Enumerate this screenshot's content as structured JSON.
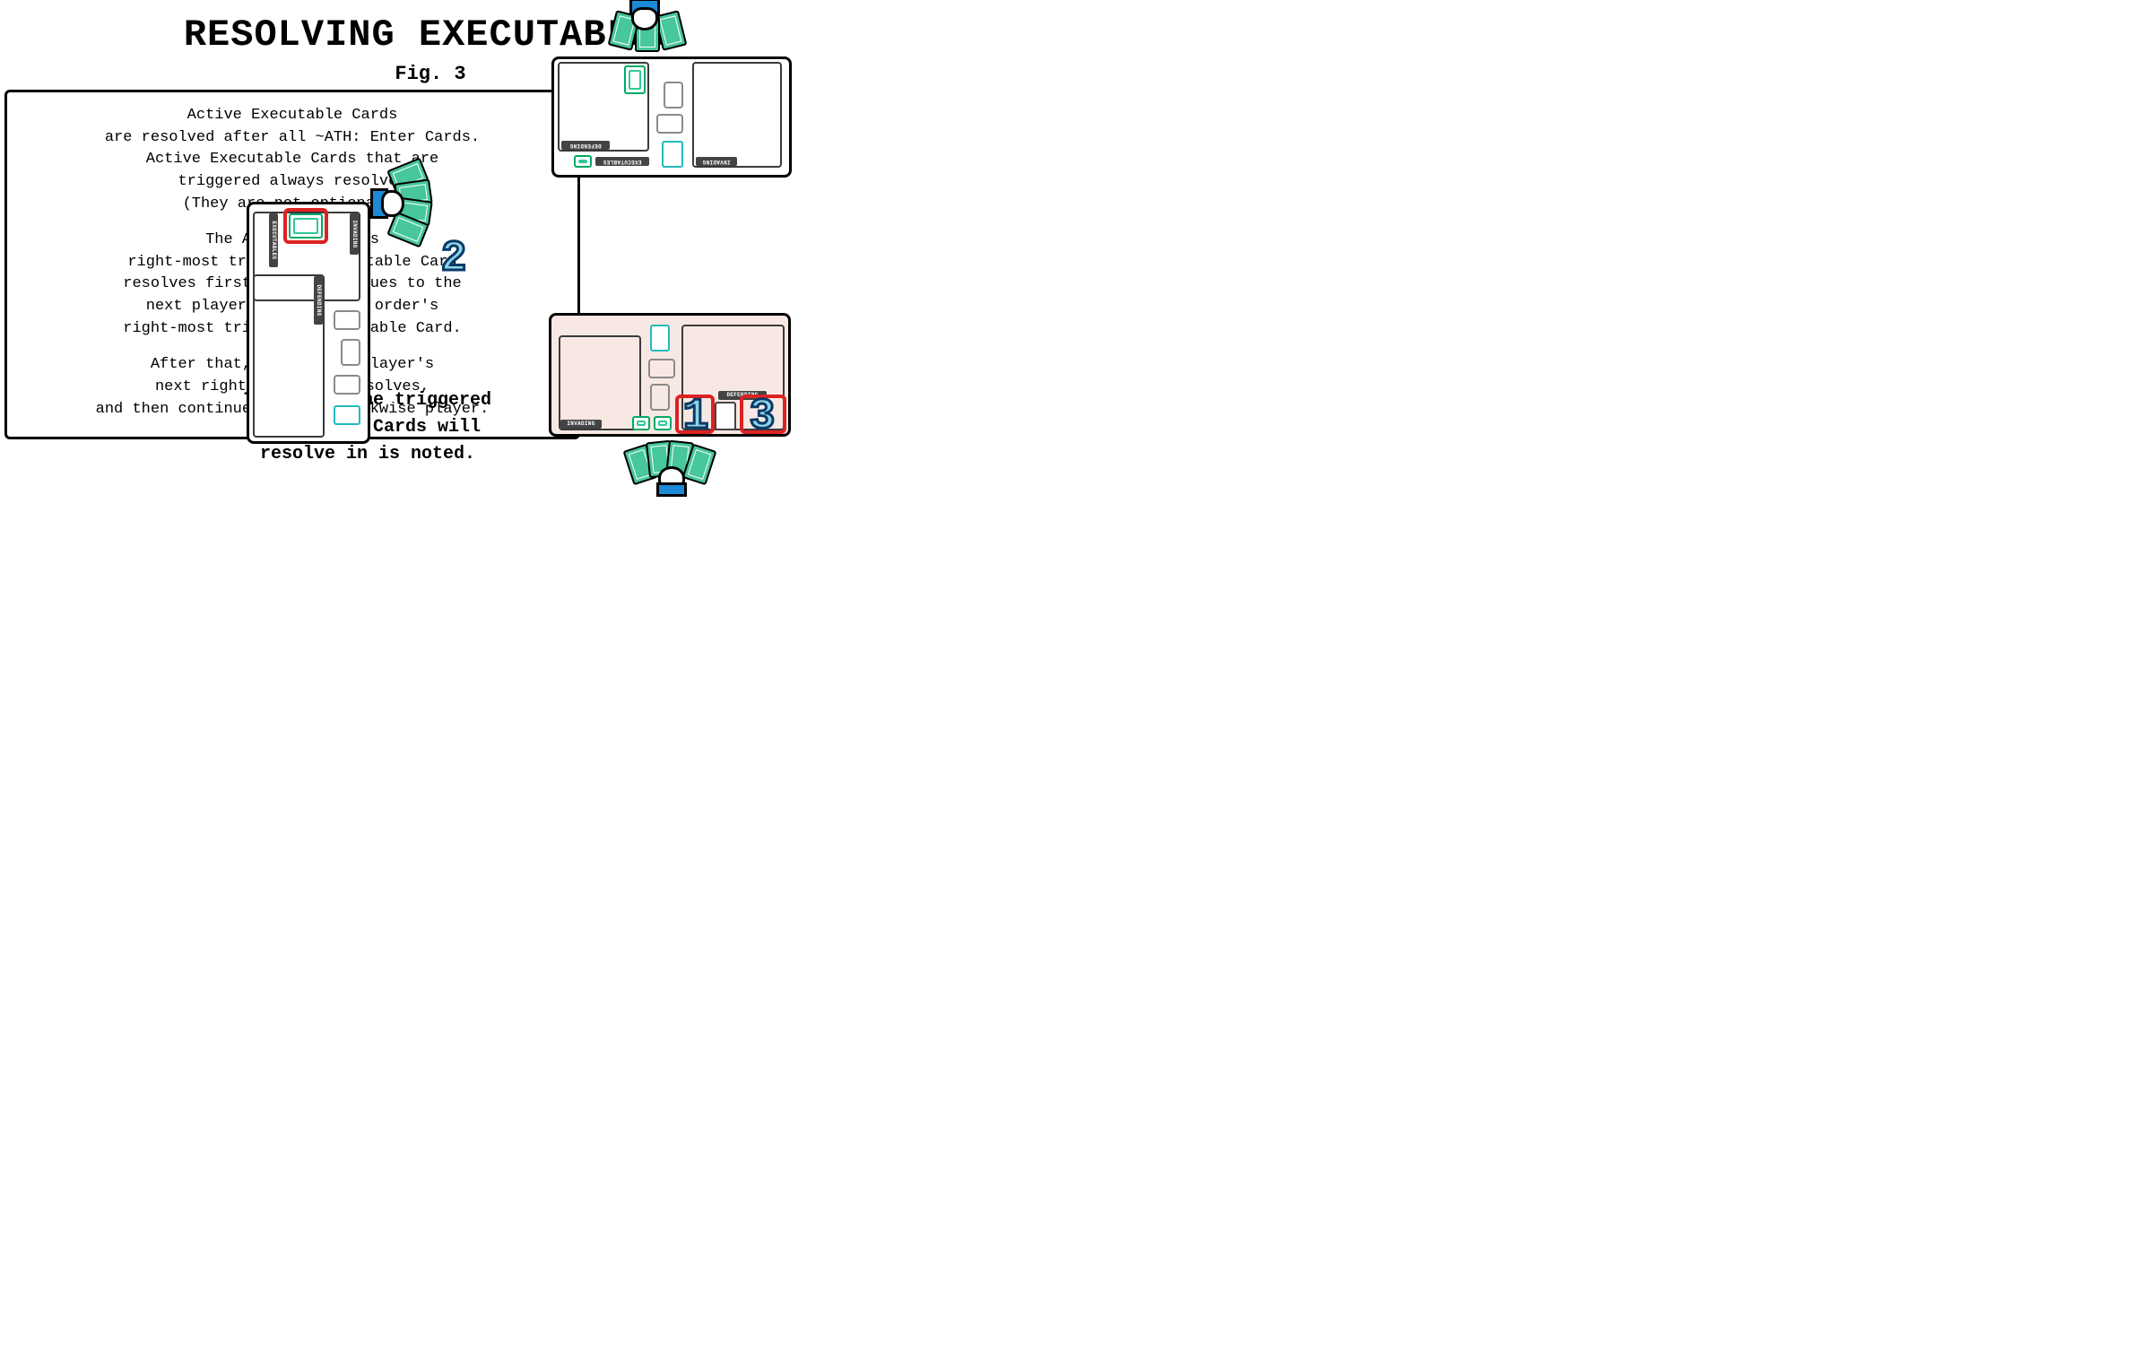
{
  "title": "RESOLVING EXECUTABLES",
  "figure_label": "Fig. 3",
  "rules": {
    "p1_l1": "Active Executable Cards",
    "p1_l2": "are resolved after all ~ATH: Enter Cards.",
    "p1_l3": "Active Executable Cards that are",
    "p1_l4": "triggered always resolve.",
    "p1_l5": "(They are not optional.)",
    "p2_l1": "The Active Player's",
    "p2_l2": "right-most triggered Executable Card",
    "p2_l3": "resolves first, then continues to the",
    "p2_l4": "next player in clockwise order's",
    "p2_l5": "right-most triggered Executable Card.",
    "p3_l1": "After that, the Acitve Player's",
    "p3_l2": "next right-most card resolves,",
    "p3_l3": "and then continues to the clockwise player."
  },
  "caption_l1": "The order the triggered",
  "caption_l2": "Executable Cards will",
  "caption_l3": "resolve in is noted.",
  "zone_labels": {
    "executables": "EXECUTABLES",
    "defending": "DEFENDING",
    "invading": "INVADING"
  },
  "order_numbers": {
    "n1": "1",
    "n2": "2",
    "n3": "3"
  },
  "players": {
    "top": {
      "role": "opponent",
      "hand_card_count": 3
    },
    "left": {
      "role": "opponent",
      "hand_card_count": 4
    },
    "bottom": {
      "role": "active",
      "hand_card_count": 4
    }
  },
  "resolution_order": [
    {
      "number": 1,
      "player": "bottom",
      "slot": "defending-right-1"
    },
    {
      "number": 2,
      "player": "left",
      "slot": "executables-right-1"
    },
    {
      "number": 3,
      "player": "bottom",
      "slot": "defending-right-2"
    }
  ]
}
